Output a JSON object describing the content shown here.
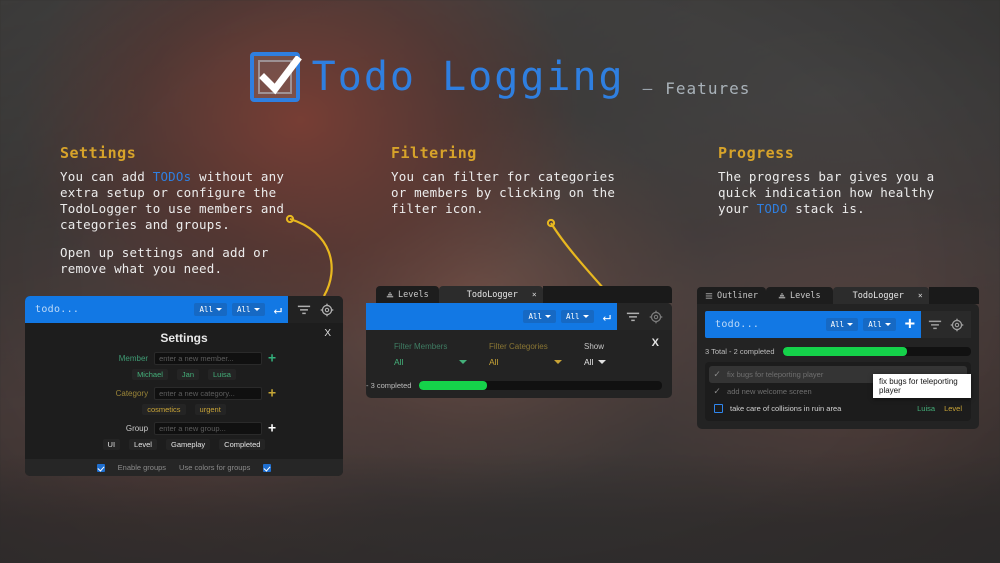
{
  "header": {
    "logo_icon": "checkbox-check-icon",
    "title": "Todo Logging",
    "dash": "–",
    "subtitle": "Features"
  },
  "features": [
    {
      "heading": "Settings",
      "para1_a": "You can add ",
      "para1_hl": "TODOs",
      "para1_b": " without any extra setup or configure the TodoLogger to use members and categories and groups.",
      "para2": "Open up settings and add or remove what you need."
    },
    {
      "heading": "Filtering",
      "para1_a": "You can filter for categories or members by clicking on the filter icon.",
      "para1_hl": "",
      "para1_b": "",
      "para2": ""
    },
    {
      "heading": "Progress",
      "para1_a": "The progress bar gives you a quick indication how healthy your ",
      "para1_hl": "TODO",
      "para1_b": " stack is.",
      "para2": ""
    }
  ],
  "settings_panel": {
    "addbar": {
      "placeholder": "todo...",
      "member_filter": "All",
      "category_filter": "All",
      "enter_icon": "enter-arrow-icon"
    },
    "tools": {
      "filter_icon": "filter-icon",
      "gear_icon": "gear-icon"
    },
    "title": "Settings",
    "close_label": "X",
    "rows": [
      {
        "label": "Member",
        "label_color": "#3f9b74",
        "placeholder": "enter a new member...",
        "add_color": "#33b07c",
        "chips": [
          "Michael",
          "Jan",
          "Luisa"
        ],
        "chip_class": "c-green"
      },
      {
        "label": "Category",
        "label_color": "#9c8638",
        "placeholder": "enter a new category...",
        "add_color": "#c7a736",
        "chips": [
          "cosmetics",
          "urgent"
        ],
        "chip_class": "c-yellow"
      },
      {
        "label": "Group",
        "label_color": "#c9c9c9",
        "placeholder": "enter a new group...",
        "add_color": "#ffffff",
        "chips": [
          "UI",
          "Level",
          "Gameplay",
          "Completed"
        ],
        "chip_class": "c-white"
      }
    ],
    "footer": {
      "enable_groups": "Enable groups",
      "use_colors": "Use colors for groups",
      "enable_groups_checked": true,
      "use_colors_checked": true
    }
  },
  "filter_panel": {
    "tabs": [
      {
        "label": "Levels",
        "icon": "levels-icon",
        "active": false,
        "closable": false
      },
      {
        "label": "TodoLogger",
        "icon": "",
        "active": true,
        "closable": true,
        "close_label": "×"
      }
    ],
    "addbar": {
      "placeholder": "",
      "member_filter": "All",
      "category_filter": "All",
      "enter_icon": "enter-arrow-icon"
    },
    "tools": {
      "filter_icon": "filter-icon",
      "gear_icon": "gear-icon"
    },
    "close_label": "X",
    "columns": [
      {
        "label": "Filter Members",
        "label_color": "#3f9b74",
        "value": "All",
        "value_color": "#44b07a"
      },
      {
        "label": "Filter Categories",
        "label_color": "#9c8638",
        "value": "All",
        "value_color": "#c9a436"
      },
      {
        "label": "Show",
        "label_color": "#c6c6c6",
        "value": "All",
        "value_color": "#e2e2e2"
      }
    ],
    "progress": {
      "text": "- 3 completed",
      "percent": 28
    }
  },
  "progress_panel": {
    "tabs": [
      {
        "label": "Outliner",
        "icon": "outliner-icon",
        "active": false,
        "closable": false
      },
      {
        "label": "Levels",
        "icon": "levels-icon",
        "active": false,
        "closable": false
      },
      {
        "label": "TodoLogger",
        "icon": "",
        "active": true,
        "closable": true,
        "close_label": "×"
      }
    ],
    "addbar": {
      "placeholder": "todo...",
      "member_filter": "All",
      "category_filter": "All",
      "plus_icon": "plus-icon"
    },
    "tools": {
      "filter_icon": "filter-icon",
      "gear_icon": "gear-icon"
    },
    "progress": {
      "text": "3 Total - 2 completed",
      "percent": 66
    },
    "todos": [
      {
        "text": "fix bugs for teleporting player",
        "done": true,
        "hovered": true,
        "tags": []
      },
      {
        "text": "add new welcome screen",
        "done": true,
        "hovered": false,
        "tags": []
      },
      {
        "text": "take care of collisions in ruin area",
        "done": false,
        "hovered": false,
        "tags": [
          {
            "label": "Luisa",
            "color": "#44b07a"
          },
          {
            "label": "Level",
            "color": "#c9a436"
          }
        ]
      }
    ],
    "tooltip": "fix bugs for teleporting player"
  },
  "colors": {
    "accent_blue": "#2f7fe0",
    "heading_gold": "#d7a32a",
    "callout_yellow": "#e8b81f",
    "progress_green": "#15d24a"
  }
}
